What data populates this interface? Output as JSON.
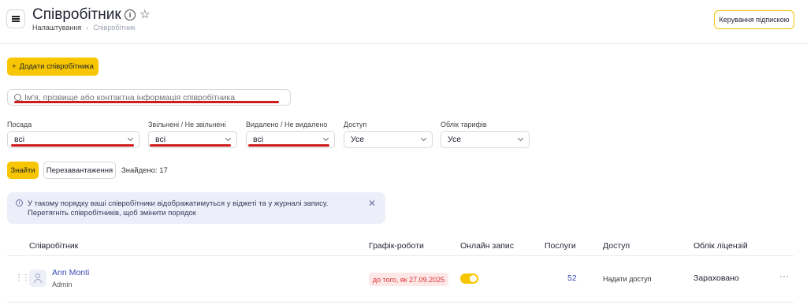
{
  "header": {
    "title": "Співробітник",
    "breadcrumb": [
      "Налаштування",
      "Співробітник"
    ],
    "subscription_button": "Керування підпискою"
  },
  "actions": {
    "add_employee": "Додати співробітника"
  },
  "search": {
    "placeholder": "Ім'я, прізвище або контактна інформація співробітника"
  },
  "filters": [
    {
      "label": "Посада",
      "value": "всі"
    },
    {
      "label": "Звільнені / Не звільнені",
      "value": "всі"
    },
    {
      "label": "Видалено / Не видалено",
      "value": "всі"
    },
    {
      "label": "Доступ",
      "value": "Усе"
    },
    {
      "label": "Облік тарифів",
      "value": "Усе"
    }
  ],
  "find_button": "Знайти",
  "reload_button": "Перезавантаження",
  "found_text": "Знайдено: 17",
  "notice": {
    "text": "У такому порядку ваші співробітники відображатимуться у віджеті та у журналі запису. Перетягніть співробітників, щоб змінити порядок"
  },
  "table": {
    "columns": [
      "Співробітник",
      "Графік-роботи",
      "Онлайн запис",
      "Послуги",
      "Доступ",
      "Облік ліцензій"
    ],
    "rows": [
      {
        "name": "Ann Monti",
        "role": "Admin",
        "schedule": "до того, як 27.09.2025",
        "online_booking": true,
        "services": "52",
        "access": "Надати доступ",
        "license": "Зараховано"
      }
    ]
  },
  "colors": {
    "accent": "#f7c600",
    "link": "#3a4bb0",
    "annotation": "#d11a1a"
  }
}
